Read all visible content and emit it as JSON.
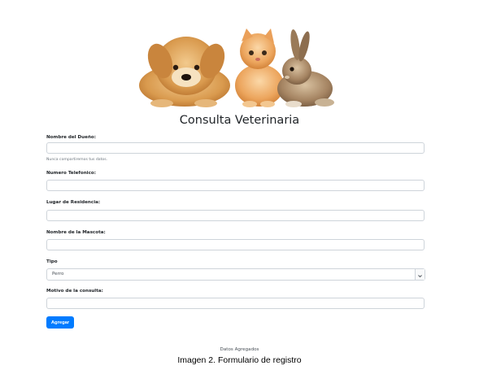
{
  "header": {
    "title": "Consulta Veterinaria"
  },
  "form": {
    "owner": {
      "label": "Nombre del Dueño:",
      "value": "",
      "help": "Nunca compartiremos tus datos."
    },
    "phone": {
      "label": "Numero Telefonico:",
      "value": ""
    },
    "residence": {
      "label": "Lugar de Residencia:",
      "value": ""
    },
    "pet_name": {
      "label": "Nombre de la Mascota:",
      "value": ""
    },
    "type": {
      "label": "Tipo",
      "selected": "Perro"
    },
    "reason": {
      "label": "Motivo de la consulta:",
      "value": ""
    },
    "submit_label": "Agregar"
  },
  "footer": {
    "note": "Datos Agregados"
  },
  "caption": "Imagen 2. Formulario de registro",
  "colors": {
    "primary": "#007bff",
    "border": "#ced4da",
    "muted": "#6c757d"
  }
}
